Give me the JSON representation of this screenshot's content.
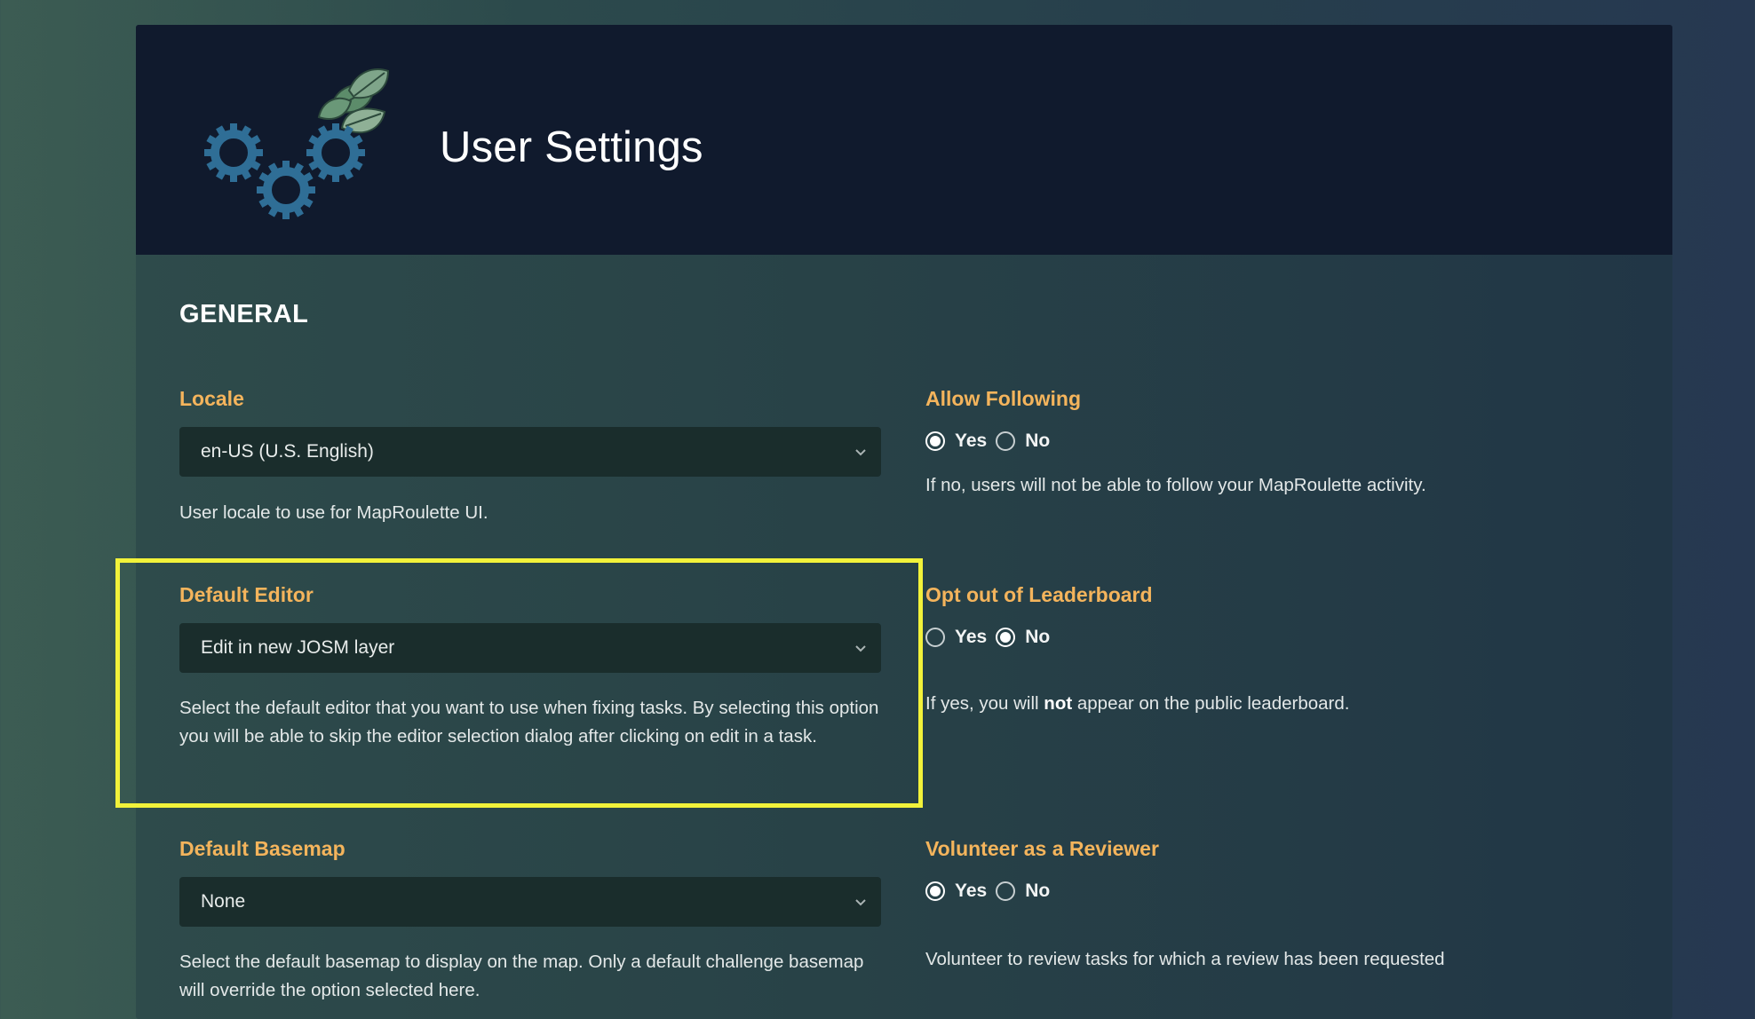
{
  "header": {
    "title": "User Settings",
    "logo_icon": "gears-with-leaves-icon"
  },
  "section": {
    "title": "GENERAL"
  },
  "left": {
    "locale": {
      "label": "Locale",
      "value": "en-US (U.S. English)",
      "help": "User locale to use for MapRoulette UI."
    },
    "default_editor": {
      "label": "Default Editor",
      "value": "Edit in new JOSM layer",
      "help": "Select the default editor that you want to use when fixing tasks. By selecting this option you will be able to skip the editor selection dialog after clicking on edit in a task."
    },
    "default_basemap": {
      "label": "Default Basemap",
      "value": "None",
      "help": "Select the default basemap to display on the map. Only a default challenge basemap will override the option selected here."
    }
  },
  "right": {
    "allow_following": {
      "label": "Allow Following",
      "yes_label": "Yes",
      "no_label": "No",
      "selected": "Yes",
      "help": "If no, users will not be able to follow your MapRoulette activity."
    },
    "leaderboard": {
      "label": "Opt out of Leaderboard",
      "yes_label": "Yes",
      "no_label": "No",
      "selected": "No",
      "help_prefix": "If yes, you will ",
      "help_bold": "not",
      "help_suffix": " appear on the public leaderboard."
    },
    "reviewer": {
      "label": "Volunteer as a Reviewer",
      "yes_label": "Yes",
      "no_label": "No",
      "selected": "Yes",
      "help": "Volunteer to review tasks for which a review has been requested"
    }
  },
  "colors": {
    "accent": "#f4b45c",
    "highlight": "#f2f23a",
    "header_bg": "#101a2d",
    "gear": "#2f6e96"
  }
}
